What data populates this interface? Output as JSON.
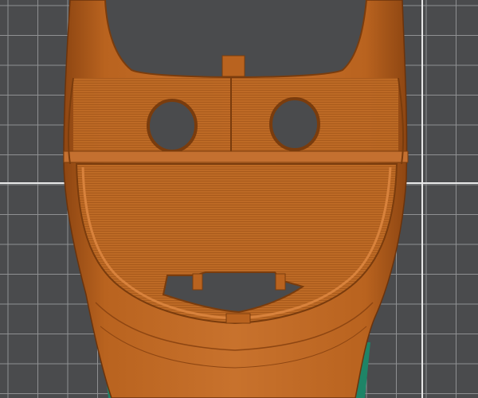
{
  "viewport": {
    "name": "slicer-preview-viewport",
    "colors": {
      "background": "#4a4b4d",
      "grid_minor": "#9a9b9d",
      "grid_major": "#eeeeee",
      "perimeter": "#b5631f",
      "perimeter_dark": "#7a3c0d",
      "infill": "#c06d29",
      "support_green": "#1f8a6c"
    }
  }
}
